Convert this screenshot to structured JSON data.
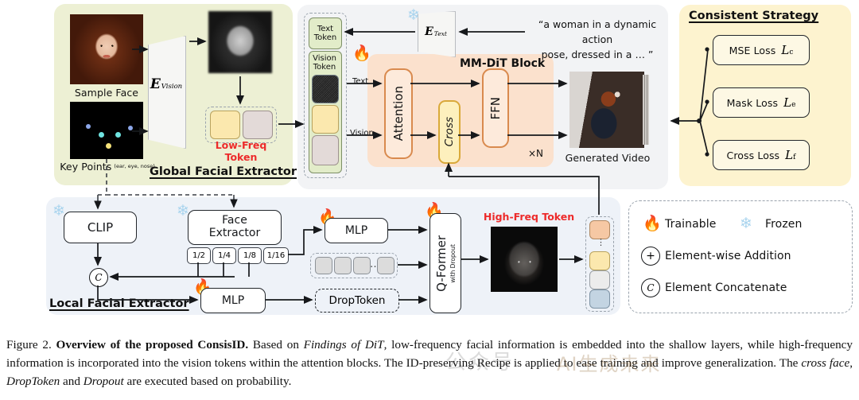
{
  "figure": {
    "caption_prefix": "Figure 2.",
    "caption_bold": "Overview of the proposed ConsisID.",
    "caption_body_1": " Based on ",
    "caption_italic_1": "Findings of DiT",
    "caption_body_2": ", low-frequency facial information is embedded into the shallow layers, while high-frequency information is incorporated into the vision tokens within the attention blocks. The ID-preserving Recipe is applied to ease training and improve generalization. The ",
    "caption_italic_2": "cross face",
    "caption_body_3": ", ",
    "caption_italic_3": "DropToken",
    "caption_body_4": " and ",
    "caption_italic_4": "Dropout",
    "caption_body_5": " are executed based on probability.",
    "watermark_1": "公众号",
    "watermark_2": "AI生成未来"
  },
  "global_extractor": {
    "title": "Global Facial Extractor",
    "sample_face_label": "Sample Face",
    "key_points_label": "Key Points",
    "key_points_sub": "(ear, eye, nose)",
    "encoder_label": "E",
    "encoder_sub": "Vision",
    "low_freq_label": "Low-Freq Token",
    "low_freq_color": "#ed2b2b",
    "panel_color": "#edf0d4"
  },
  "dit_section": {
    "panel_color": "#f2f3f5",
    "mmdit_title": "MM-DiT Block",
    "mmdit_color": "#fbe1cd",
    "text_token_label": "Text\nToken",
    "text_token_line1": "Text",
    "text_token_line2": "Token",
    "vision_token_line1": "Vision",
    "vision_token_line2": "Token",
    "text_encoder_label": "E",
    "text_encoder_sub": "Text",
    "prompt_line1": "“a woman in a dynamic action",
    "prompt_line2": "pose, dressed in a … ”",
    "blocks": [
      {
        "name": "Attention"
      },
      {
        "name": "Cross"
      },
      {
        "name": "FFN"
      }
    ],
    "stream_text": "Text",
    "stream_vision": "Vision",
    "repeat_label": "×N",
    "generated_video_label": "Generated Video"
  },
  "consistent_strategy": {
    "title": "Consistent Strategy",
    "panel_color": "#fdf3cf",
    "losses": [
      {
        "name": "MSE Loss",
        "symbol": "L",
        "subscript": "c"
      },
      {
        "name": "Mask Loss",
        "symbol": "L",
        "subscript": "e"
      },
      {
        "name": "Cross Loss",
        "symbol": "L",
        "subscript": "f"
      }
    ]
  },
  "local_extractor": {
    "title": "Local Facial Extractor",
    "panel_color": "#eef2f8",
    "clip_label": "CLIP",
    "face_extractor_line1": "Face",
    "face_extractor_line2": "Extractor",
    "scales": [
      "1/2",
      "1/4",
      "1/8",
      "1/16"
    ],
    "mlp_top_label": "MLP",
    "mlp_bottom_label": "MLP",
    "concat_symbol": "C",
    "droptoken_label": "DropToken",
    "qformer_label": "Q-Former",
    "qformer_sub": "with Dropout",
    "high_freq_label": "High-Freq Token",
    "high_freq_color": "#ed2b2b",
    "query_tokens_ellipsis": "…"
  },
  "legend": {
    "trainable_label": "Trainable",
    "frozen_label": "Frozen",
    "addition_label": "Element-wise Addition",
    "addition_symbol": "+",
    "concatenate_label": "Element Concatenate",
    "concatenate_symbol": "C",
    "flame_icon": "🔥",
    "snowflake_icon": "❄"
  }
}
